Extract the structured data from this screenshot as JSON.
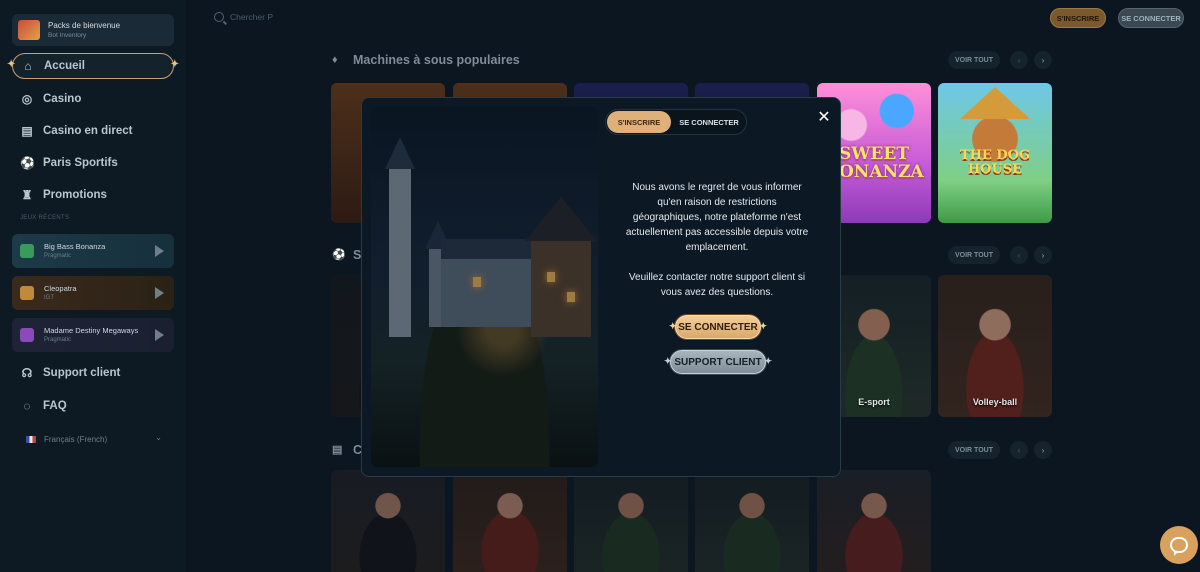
{
  "sidebar": {
    "welcome": {
      "title": "Packs de bienvenue",
      "subtitle": "Bot Inventory"
    },
    "nav": [
      {
        "label": "Accueil",
        "icon": "home-icon",
        "active": true
      },
      {
        "label": "Casino",
        "icon": "casino-chip-icon"
      },
      {
        "label": "Casino en direct",
        "icon": "cards-icon"
      },
      {
        "label": "Paris Sportifs",
        "icon": "soccer-ball-icon"
      },
      {
        "label": "Promotions",
        "icon": "trophy-icon"
      }
    ],
    "recent_label": "JEUX RÉCENTS",
    "recent_games": [
      {
        "name": "Big Bass Bonanza",
        "status": "Pragmatic"
      },
      {
        "name": "Cleopatra",
        "status": "IGT"
      },
      {
        "name": "Madame Destiny Megaways",
        "status": "Pragmatic"
      }
    ],
    "support": "Support client",
    "faq": "FAQ",
    "language": "Français (French)"
  },
  "header": {
    "search_placeholder": "Chercher P",
    "register": "S'INSCRIRE",
    "login": "SE CONNECTER"
  },
  "sections": [
    {
      "title": "Machines à sous populaires",
      "voir_tout": "VOIR TOUT"
    },
    {
      "title": "S",
      "voir_tout": "VOIR TOUT"
    },
    {
      "title": "C",
      "voir_tout": "VOIR TOUT"
    }
  ],
  "tiles": {
    "sweet_bonanza": "SWEET BONANZA",
    "dog_house": "THE DOG HOUSE",
    "esport": "E-sport",
    "volley": "Volley-ball"
  },
  "modal": {
    "tab_register": "S'INSCRIRE",
    "tab_login": "SE CONNECTER",
    "message_1": "Nous avons le regret de vous informer qu'en raison de restrictions géographiques, notre plateforme n'est actuellement pas accessible depuis votre emplacement.",
    "message_2": "Veuillez contacter notre support client si vous avez des questions.",
    "connect_button": "SE CONNECTER",
    "support_button": "SUPPORT CLIENT"
  },
  "colors": {
    "accent_gold": "#e0b07a",
    "background": "#0b1620",
    "modal_bg": "#0c1925"
  }
}
